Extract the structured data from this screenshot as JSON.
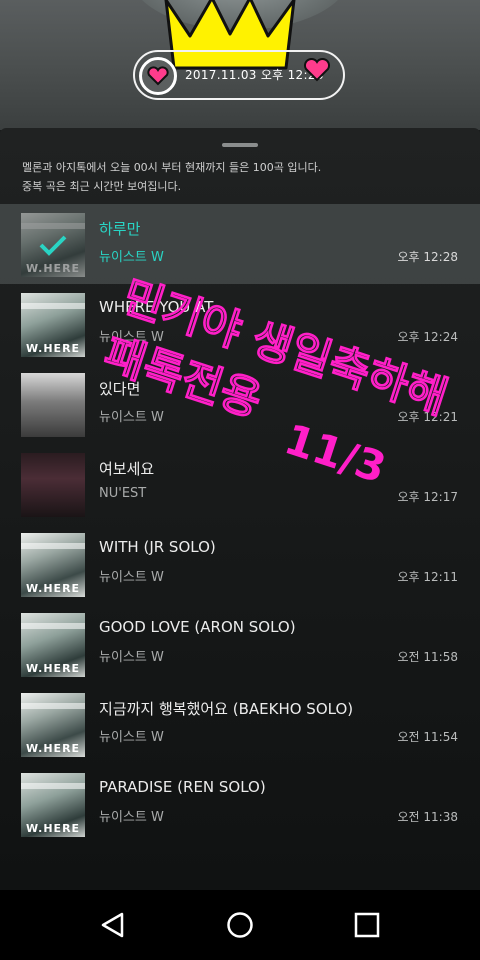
{
  "header": {
    "date_time": "2017.11.03 오후 12:28"
  },
  "info": {
    "line1": "멜론과 아지톡에서 오늘 00시 부터 현재까지 들은 100곡 입니다.",
    "line2": "중복 곡은 최근 시간만 보여집니다."
  },
  "songs": [
    {
      "title": "하루만",
      "artist": "뉴이스트 W",
      "time": "오후 12:28"
    },
    {
      "title": "WHERE YOU AT",
      "artist": "뉴이스트 W",
      "time": "오후 12:24"
    },
    {
      "title": "있다면",
      "artist": "뉴이스트 W",
      "time": "오후 12:21"
    },
    {
      "title": "여보세요",
      "artist": "NU'EST",
      "time": "오후 12:17"
    },
    {
      "title": "WITH (JR SOLO)",
      "artist": "뉴이스트 W",
      "time": "오후 12:11"
    },
    {
      "title": "GOOD LOVE (ARON SOLO)",
      "artist": "뉴이스트 W",
      "time": "오전 11:58"
    },
    {
      "title": "지금까지 행복했어요 (BAEKHO SOLO)",
      "artist": "뉴이스트 W",
      "time": "오전 11:54"
    },
    {
      "title": "PARADISE (REN SOLO)",
      "artist": "뉴이스트 W",
      "time": "오전 11:38"
    }
  ],
  "album_label": "W.HERE",
  "overlay": {
    "line1": "민기야 생일축하해",
    "line2": "패톡전용",
    "line3": "11/3",
    "color": "#ff1fc8"
  },
  "navbar": {
    "icons": [
      "back-icon",
      "home-icon",
      "recents-icon"
    ]
  },
  "colors": {
    "accent": "#29d4c4",
    "crown": "#fff200",
    "heart": "#ff3c8c"
  }
}
